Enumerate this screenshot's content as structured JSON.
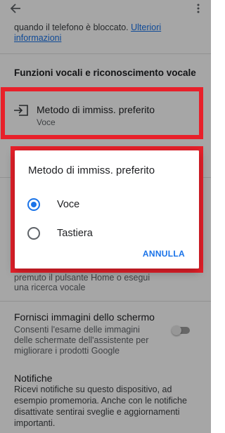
{
  "header": {
    "back_icon": "arrow-back-icon",
    "more_icon": "more-vert-icon"
  },
  "intro": {
    "text": "quando il telefono è bloccato.",
    "link": "Ulteriori informazioni"
  },
  "section": {
    "title": "Funzioni vocali e riconoscimento vocale"
  },
  "preferred_input": {
    "icon": "input-icon",
    "title": "Metodo di immiss. preferito",
    "subtitle": "Voce"
  },
  "background_items": {
    "partial_text_1": "premuto il pulsante Home o esegui",
    "partial_text_2": "una ricerca vocale",
    "screenshots_title": "Fornisci immagini dello schermo",
    "screenshots_desc_1": "Consenti l'esame delle immagini",
    "screenshots_desc_2": "delle schermate dell'assistente per",
    "screenshots_desc_3": "migliorare i prodotti Google",
    "screenshots_toggle": "off",
    "notifications_title": "Notifiche",
    "notifications_desc_1": "Ricevi notifiche su questo dispositivo, ad",
    "notifications_desc_2": "esempio promemoria. Anche con le notifiche",
    "notifications_desc_3": "disattivate sentirai sveglie e aggiornamenti",
    "notifications_desc_4": "importanti."
  },
  "dialog": {
    "title": "Metodo di immiss. preferito",
    "options": [
      {
        "label": "Voce",
        "selected": true
      },
      {
        "label": "Tastiera",
        "selected": false
      }
    ],
    "cancel_label": "ANNULLA"
  },
  "colors": {
    "accent": "#1a73e8",
    "highlight": "#e8202a"
  }
}
